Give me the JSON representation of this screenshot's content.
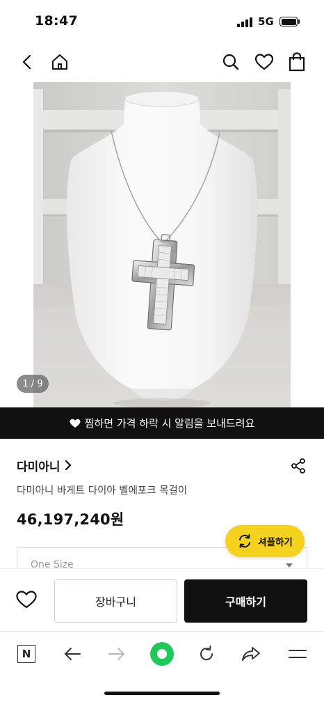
{
  "status_bar": {
    "time": "18:47",
    "network": "5G"
  },
  "hero": {
    "image_counter": "1 / 9"
  },
  "price_alert_banner": {
    "text": "찜하면 가격 하락 시 알림을 보내드려요"
  },
  "product": {
    "brand": "다미아니",
    "name": "다미아니 바게트 다이아 벨에포크 목걸이",
    "price": "46,197,240원"
  },
  "shuffle_button": {
    "label": "셔플하기"
  },
  "size_select": {
    "value": "One Size"
  },
  "purchase_bar": {
    "cart_label": "장바구니",
    "buy_label": "구매하기"
  },
  "browser_bar": {
    "logo_letter": "N"
  },
  "colors": {
    "accent_yellow": "#f5d21e",
    "banner_black": "#111111",
    "browser_green": "#1ec95a"
  }
}
